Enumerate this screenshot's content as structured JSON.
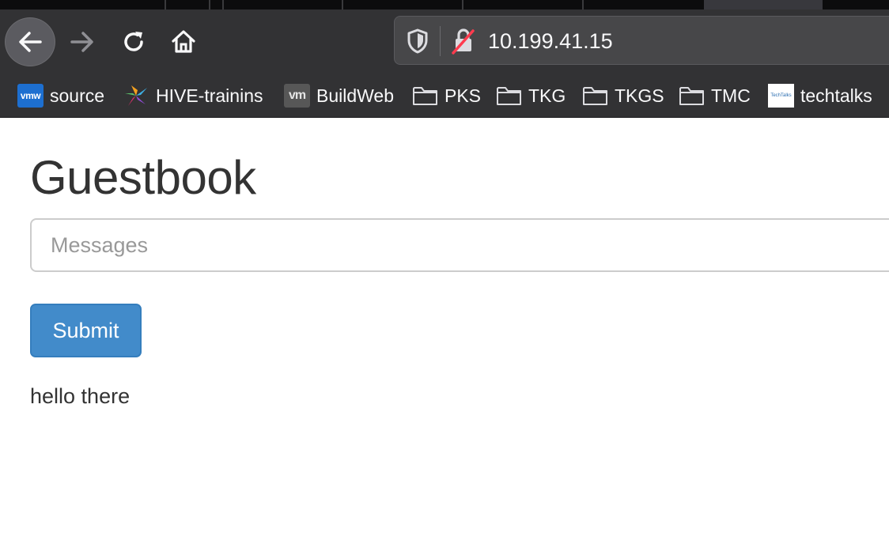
{
  "browser": {
    "url": "10.199.41.15",
    "bookmarks": [
      {
        "label": "source",
        "icon": "vmw-icon",
        "icon_text": "vmw"
      },
      {
        "label": "HIVE-trainins",
        "icon": "hive-icon"
      },
      {
        "label": "BuildWeb",
        "icon": "vm-icon",
        "icon_text": "vm"
      },
      {
        "label": "PKS",
        "icon": "folder-icon"
      },
      {
        "label": "TKG",
        "icon": "folder-icon"
      },
      {
        "label": "TKGS",
        "icon": "folder-icon"
      },
      {
        "label": "TMC",
        "icon": "folder-icon"
      },
      {
        "label": "techtalks",
        "icon": "techtalks-icon",
        "icon_text": "TechTalks"
      }
    ]
  },
  "page": {
    "title": "Guestbook",
    "input_placeholder": "Messages",
    "input_value": "",
    "submit_label": "Submit",
    "entries": [
      "hello there"
    ]
  },
  "colors": {
    "chrome_bg": "#323234",
    "submit_bg": "#428bca",
    "text": "#333333"
  }
}
